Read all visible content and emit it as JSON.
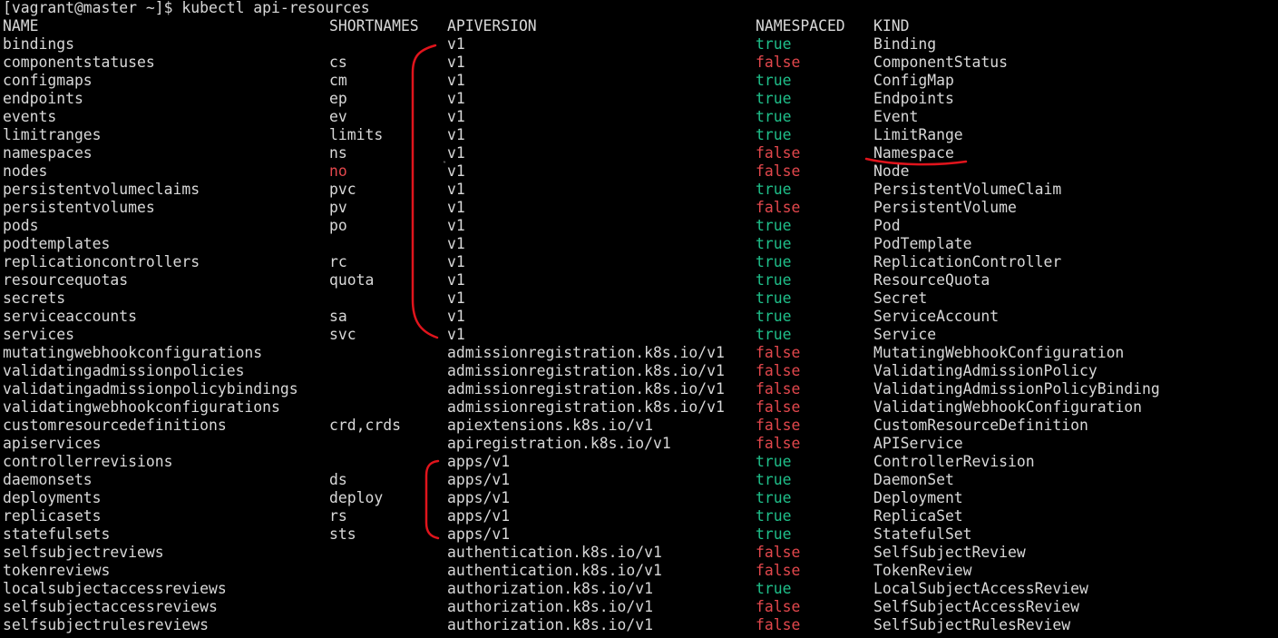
{
  "terminal": {
    "prompt": "[vagrant@master ~]$ kubectl api-resources",
    "headers": {
      "name": "NAME",
      "shortnames": "SHORTNAMES",
      "apiversion": "APIVERSION",
      "namespaced": "NAMESPACED",
      "kind": "KIND"
    },
    "rows": [
      {
        "name": "bindings",
        "shortnames": "",
        "apiversion": "v1",
        "namespaced": "true",
        "kind": "Binding"
      },
      {
        "name": "componentstatuses",
        "shortnames": "cs",
        "apiversion": "v1",
        "namespaced": "false",
        "kind": "ComponentStatus"
      },
      {
        "name": "configmaps",
        "shortnames": "cm",
        "apiversion": "v1",
        "namespaced": "true",
        "kind": "ConfigMap"
      },
      {
        "name": "endpoints",
        "shortnames": "ep",
        "apiversion": "v1",
        "namespaced": "true",
        "kind": "Endpoints"
      },
      {
        "name": "events",
        "shortnames": "ev",
        "apiversion": "v1",
        "namespaced": "true",
        "kind": "Event"
      },
      {
        "name": "limitranges",
        "shortnames": "limits",
        "apiversion": "v1",
        "namespaced": "true",
        "kind": "LimitRange"
      },
      {
        "name": "namespaces",
        "shortnames": "ns",
        "apiversion": "v1",
        "namespaced": "false",
        "kind": "Namespace"
      },
      {
        "name": "nodes",
        "shortnames": "no",
        "apiversion": "v1",
        "namespaced": "false",
        "kind": "Node"
      },
      {
        "name": "persistentvolumeclaims",
        "shortnames": "pvc",
        "apiversion": "v1",
        "namespaced": "true",
        "kind": "PersistentVolumeClaim"
      },
      {
        "name": "persistentvolumes",
        "shortnames": "pv",
        "apiversion": "v1",
        "namespaced": "false",
        "kind": "PersistentVolume"
      },
      {
        "name": "pods",
        "shortnames": "po",
        "apiversion": "v1",
        "namespaced": "true",
        "kind": "Pod"
      },
      {
        "name": "podtemplates",
        "shortnames": "",
        "apiversion": "v1",
        "namespaced": "true",
        "kind": "PodTemplate"
      },
      {
        "name": "replicationcontrollers",
        "shortnames": "rc",
        "apiversion": "v1",
        "namespaced": "true",
        "kind": "ReplicationController"
      },
      {
        "name": "resourcequotas",
        "shortnames": "quota",
        "apiversion": "v1",
        "namespaced": "true",
        "kind": "ResourceQuota"
      },
      {
        "name": "secrets",
        "shortnames": "",
        "apiversion": "v1",
        "namespaced": "true",
        "kind": "Secret"
      },
      {
        "name": "serviceaccounts",
        "shortnames": "sa",
        "apiversion": "v1",
        "namespaced": "true",
        "kind": "ServiceAccount"
      },
      {
        "name": "services",
        "shortnames": "svc",
        "apiversion": "v1",
        "namespaced": "true",
        "kind": "Service"
      },
      {
        "name": "mutatingwebhookconfigurations",
        "shortnames": "",
        "apiversion": "admissionregistration.k8s.io/v1",
        "namespaced": "false",
        "kind": "MutatingWebhookConfiguration"
      },
      {
        "name": "validatingadmissionpolicies",
        "shortnames": "",
        "apiversion": "admissionregistration.k8s.io/v1",
        "namespaced": "false",
        "kind": "ValidatingAdmissionPolicy"
      },
      {
        "name": "validatingadmissionpolicybindings",
        "shortnames": "",
        "apiversion": "admissionregistration.k8s.io/v1",
        "namespaced": "false",
        "kind": "ValidatingAdmissionPolicyBinding"
      },
      {
        "name": "validatingwebhookconfigurations",
        "shortnames": "",
        "apiversion": "admissionregistration.k8s.io/v1",
        "namespaced": "false",
        "kind": "ValidatingWebhookConfiguration"
      },
      {
        "name": "customresourcedefinitions",
        "shortnames": "crd,crds",
        "apiversion": "apiextensions.k8s.io/v1",
        "namespaced": "false",
        "kind": "CustomResourceDefinition"
      },
      {
        "name": "apiservices",
        "shortnames": "",
        "apiversion": "apiregistration.k8s.io/v1",
        "namespaced": "false",
        "kind": "APIService"
      },
      {
        "name": "controllerrevisions",
        "shortnames": "",
        "apiversion": "apps/v1",
        "namespaced": "true",
        "kind": "ControllerRevision"
      },
      {
        "name": "daemonsets",
        "shortnames": "ds",
        "apiversion": "apps/v1",
        "namespaced": "true",
        "kind": "DaemonSet"
      },
      {
        "name": "deployments",
        "shortnames": "deploy",
        "apiversion": "apps/v1",
        "namespaced": "true",
        "kind": "Deployment"
      },
      {
        "name": "replicasets",
        "shortnames": "rs",
        "apiversion": "apps/v1",
        "namespaced": "true",
        "kind": "ReplicaSet"
      },
      {
        "name": "statefulsets",
        "shortnames": "sts",
        "apiversion": "apps/v1",
        "namespaced": "true",
        "kind": "StatefulSet"
      },
      {
        "name": "selfsubjectreviews",
        "shortnames": "",
        "apiversion": "authentication.k8s.io/v1",
        "namespaced": "false",
        "kind": "SelfSubjectReview"
      },
      {
        "name": "tokenreviews",
        "shortnames": "",
        "apiversion": "authentication.k8s.io/v1",
        "namespaced": "false",
        "kind": "TokenReview"
      },
      {
        "name": "localsubjectaccessreviews",
        "shortnames": "",
        "apiversion": "authorization.k8s.io/v1",
        "namespaced": "true",
        "kind": "LocalSubjectAccessReview"
      },
      {
        "name": "selfsubjectaccessreviews",
        "shortnames": "",
        "apiversion": "authorization.k8s.io/v1",
        "namespaced": "false",
        "kind": "SelfSubjectAccessReview"
      },
      {
        "name": "selfsubjectrulesreviews",
        "shortnames": "",
        "apiversion": "authorization.k8s.io/v1",
        "namespaced": "false",
        "kind": "SelfSubjectRulesReview"
      }
    ]
  },
  "colors": {
    "background": "#000000",
    "text": "#d8d8d8",
    "true": "#1fbf8a",
    "false": "#e2474c",
    "highlight_short": "#e2474c",
    "annotation": "#e0141c"
  },
  "highlighted_shortname": "no"
}
